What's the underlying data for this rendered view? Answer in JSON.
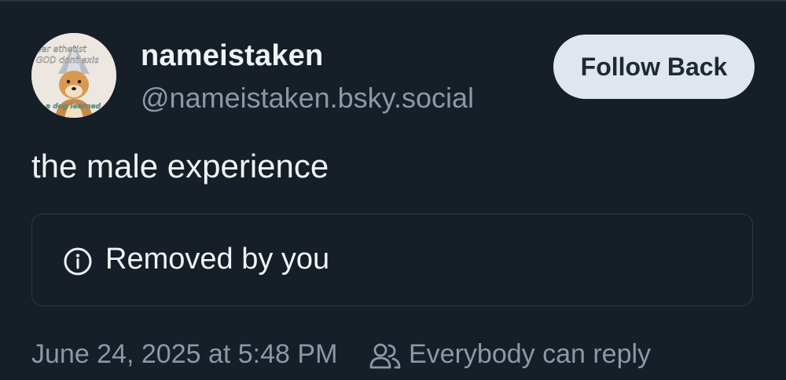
{
  "author": {
    "display_name": "nameistaken",
    "handle": "@nameistaken.bsky.social",
    "avatar_text_top": "ear athetist",
    "avatar_text_mid": "GOD dont exis",
    "avatar_text_bottom": "a dog learned"
  },
  "follow_button": {
    "label": "Follow Back"
  },
  "post": {
    "text": "the male experience"
  },
  "removed_notice": {
    "label": "Removed by you",
    "icon": "info-icon"
  },
  "meta": {
    "timestamp": "June 24, 2025 at 5:48 PM",
    "reply_setting": "Everybody can reply",
    "reply_icon": "people-icon"
  },
  "colors": {
    "background": "#161e27",
    "primary_text": "#f1f3f5",
    "secondary_text": "#8b98a8",
    "button_bg": "#dfe6ee",
    "button_text": "#1e2935",
    "border": "#2e3946"
  }
}
